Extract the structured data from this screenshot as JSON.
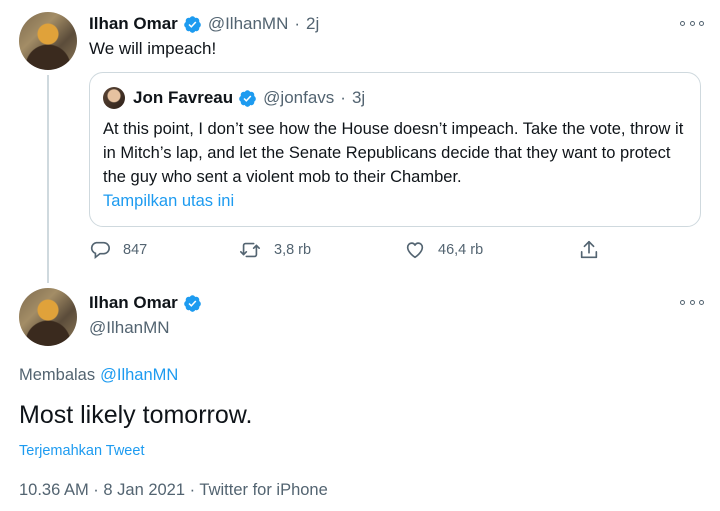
{
  "first_tweet": {
    "author_name": "Ilhan Omar",
    "handle": "@IlhanMN",
    "separator": "·",
    "time": "2j",
    "text": "We will impeach!",
    "quote": {
      "author_name": "Jon Favreau",
      "handle": "@jonfavs",
      "separator": "·",
      "time": "3j",
      "text": "At this point, I don’t see how the House doesn’t impeach. Take the vote, throw it in Mitch’s lap, and let the Senate Republicans decide that they want to protect the guy who sent a violent mob to their Chamber.",
      "show_thread": "Tampilkan utas ini"
    },
    "actions": {
      "reply_count": "847",
      "retweet_count": "3,8 rb",
      "like_count": "46,4 rb"
    }
  },
  "main_tweet": {
    "author_name": "Ilhan Omar",
    "handle": "@IlhanMN",
    "replying_prefix": "Membalas",
    "replying_to": "@IlhanMN",
    "text": "Most likely tomorrow.",
    "translate": "Terjemahkan Tweet",
    "meta": "10.36 AM · 8 Jan 2021 · Twitter for iPhone"
  },
  "colors": {
    "accent": "#1d9bf0",
    "muted": "#536471",
    "text": "#0f1419",
    "border": "#cfd9de"
  },
  "icons": [
    "verified-badge-icon",
    "more-options-icon",
    "reply-icon",
    "retweet-icon",
    "like-icon",
    "share-icon"
  ]
}
